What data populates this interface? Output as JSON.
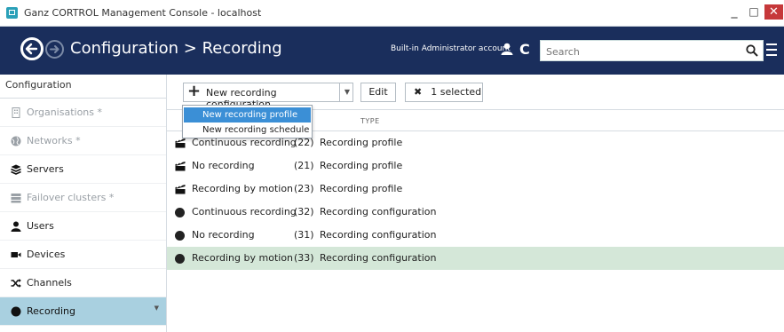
{
  "window": {
    "title": "Ganz CORTROL Management Console - localhost",
    "min_label": "_",
    "max_label": "□",
    "close_label": "✕"
  },
  "header": {
    "breadcrumb": "Configuration > Recording",
    "account": "Built-in Administrator account",
    "search_placeholder": "Search",
    "bg_color": "#1a2e5c"
  },
  "sidebar": {
    "heading": "Configuration",
    "items": [
      {
        "label": "Organisations *",
        "icon": "building-icon",
        "state": "disabled"
      },
      {
        "label": "Networks *",
        "icon": "globe-icon",
        "state": "disabled"
      },
      {
        "label": "Servers",
        "icon": "stack-icon",
        "state": "normal"
      },
      {
        "label": "Failover clusters *",
        "icon": "server-rack-icon",
        "state": "disabled"
      },
      {
        "label": "Users",
        "icon": "user-icon",
        "state": "normal"
      },
      {
        "label": "Devices",
        "icon": "camera-icon",
        "state": "normal"
      },
      {
        "label": "Channels",
        "icon": "shuffle-icon",
        "state": "normal"
      },
      {
        "label": "Recording",
        "icon": "record-dot-icon",
        "state": "active"
      }
    ],
    "active_color": "#a9d0e0"
  },
  "toolbar": {
    "new_label": "New recording configuration",
    "edit_label": "Edit",
    "selected_label": "1 selected"
  },
  "dropdown": {
    "items": [
      "New recording profile",
      "New recording schedule"
    ],
    "highlight_color": "#3b8fd6"
  },
  "table": {
    "type_header": "TYPE",
    "rows": [
      {
        "name": "Continuous recording",
        "num": "(22)",
        "type": "Recording profile",
        "icon": "film-clapper-icon"
      },
      {
        "name": "No recording",
        "num": "(21)",
        "type": "Recording profile",
        "icon": "film-clapper-icon"
      },
      {
        "name": "Recording by motion",
        "num": "(23)",
        "type": "Recording profile",
        "icon": "film-clapper-icon"
      },
      {
        "name": "Continuous recording",
        "num": "(32)",
        "type": "Recording configuration",
        "icon": "record-dot-icon"
      },
      {
        "name": "No recording",
        "num": "(31)",
        "type": "Recording configuration",
        "icon": "record-dot-icon"
      },
      {
        "name": "Recording by motion",
        "num": "(33)",
        "type": "Recording configuration",
        "icon": "record-dot-icon",
        "selected": true
      }
    ],
    "selected_color": "#d4e7d8"
  }
}
